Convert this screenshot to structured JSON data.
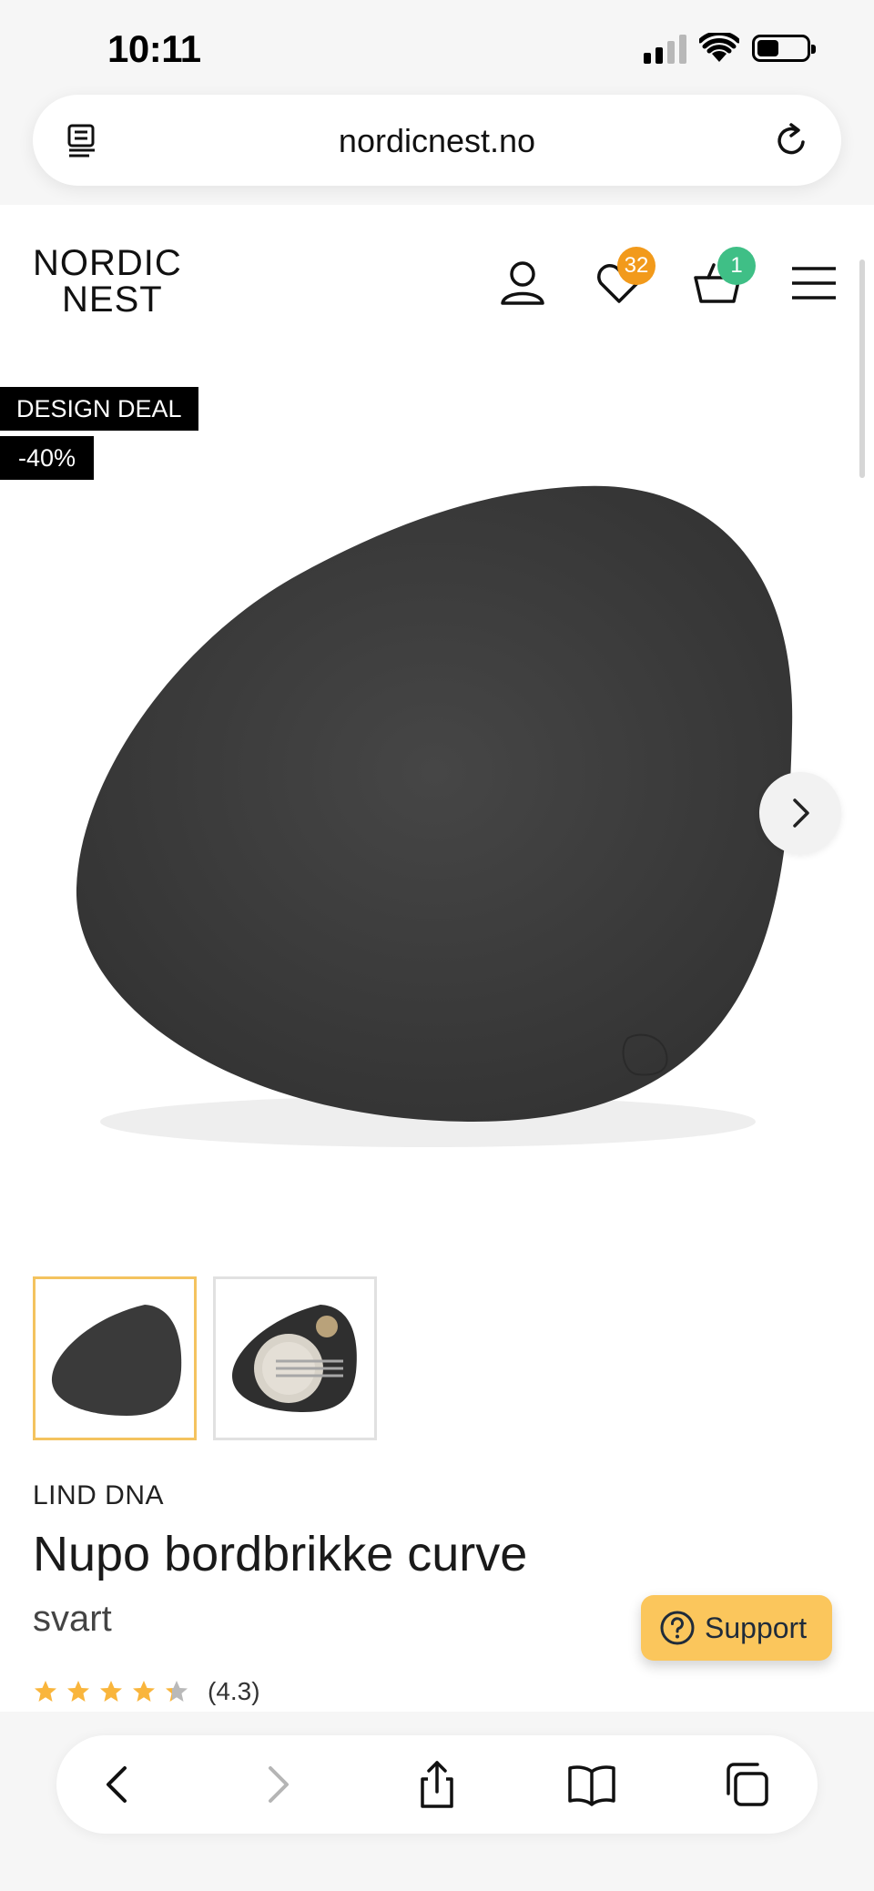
{
  "status_bar": {
    "time": "10:11"
  },
  "browser": {
    "url": "nordicnest.no"
  },
  "site": {
    "logo_line1": "NORDIC",
    "logo_line2": "NEST",
    "wishlist_count": "32",
    "cart_count": "1",
    "colors": {
      "wishlist_badge": "#f29a1b",
      "cart_badge": "#3fbf86",
      "thumb_active_border": "#f4c35f",
      "support_button": "#fbc65c",
      "star": "#f9b53c"
    }
  },
  "product": {
    "tags": [
      "DESIGN DEAL",
      "-40%"
    ],
    "brand": "LIND DNA",
    "name": "Nupo bordbrikke curve",
    "variant": "svart",
    "rating_text": "(4.3)",
    "rating_value": 4.3,
    "rating_max": 5,
    "thumbnails": [
      "placemat-front",
      "placemat-with-plate"
    ]
  },
  "support": {
    "label": "Support"
  },
  "toolbar_icons": [
    "back-icon",
    "forward-icon",
    "share-icon",
    "bookmarks-icon",
    "tabs-icon"
  ]
}
